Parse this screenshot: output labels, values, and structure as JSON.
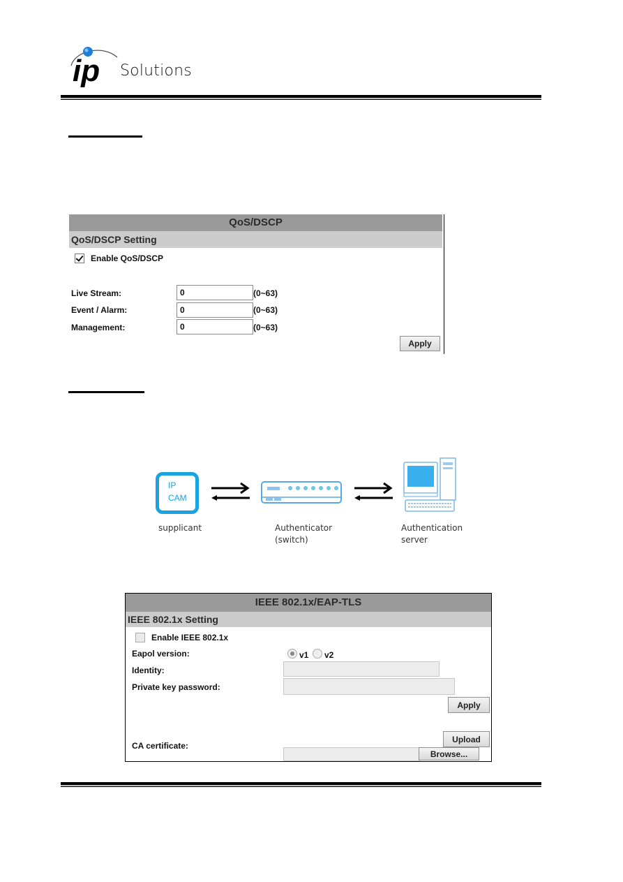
{
  "header": {
    "brand_mark": "ip",
    "brand_text": "Solutions"
  },
  "qos_panel": {
    "title": "QoS/DSCP",
    "section": "QoS/DSCP Setting",
    "enable_label": "Enable QoS/DSCP",
    "enable_checked": true,
    "fields": [
      {
        "label": "Live Stream:",
        "value": "0",
        "range": "(0~63)"
      },
      {
        "label": "Event / Alarm:",
        "value": "0",
        "range": "(0~63)"
      },
      {
        "label": "Management:",
        "value": "0",
        "range": "(0~63)"
      }
    ],
    "apply_label": "Apply"
  },
  "diagram": {
    "camera_label_line1": "IP",
    "camera_label_line2": "CAM",
    "supplicant_caption": "supplicant",
    "authenticator_caption_line1": "Authenticator",
    "authenticator_caption_line2": "(switch)",
    "server_caption_line1": "Authentication",
    "server_caption_line2": "server",
    "accent_color": "#1aa3e0"
  },
  "ieee_panel": {
    "title": "IEEE 802.1x/EAP-TLS",
    "section": "IEEE 802.1x Setting",
    "enable_label": "Enable IEEE 802.1x",
    "enable_checked": false,
    "eapol_label": "Eapol version:",
    "eapol_options": [
      {
        "label": "v1",
        "selected": true
      },
      {
        "label": "v2",
        "selected": false
      }
    ],
    "identity_label": "Identity:",
    "identity_value": "",
    "private_key_label": "Private key password:",
    "private_key_value": "",
    "apply_label": "Apply",
    "ca_label": "CA certificate:",
    "upload_label": "Upload",
    "browse_label": "Browse...",
    "file_value": ""
  }
}
